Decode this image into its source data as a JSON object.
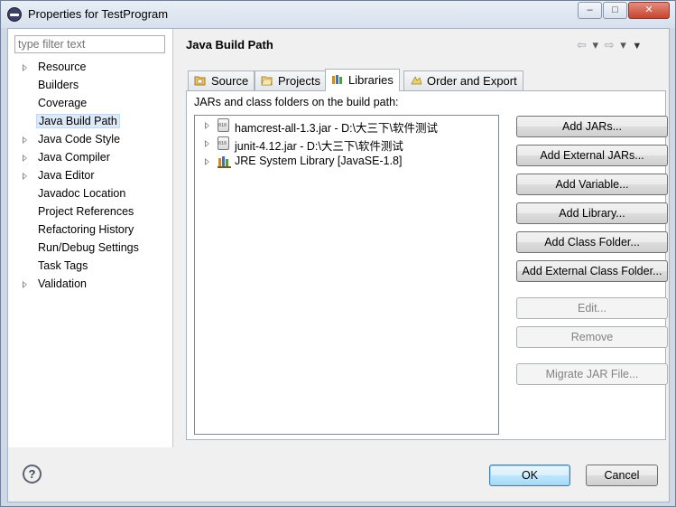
{
  "window": {
    "title": "Properties for TestProgram",
    "min_label": "–",
    "max_label": "□",
    "close_label": "✕"
  },
  "sidebar": {
    "filter_placeholder": "type filter text",
    "items": [
      {
        "label": "Resource",
        "expandable": true
      },
      {
        "label": "Builders",
        "expandable": false
      },
      {
        "label": "Coverage",
        "expandable": false
      },
      {
        "label": "Java Build Path",
        "expandable": false,
        "selected": true
      },
      {
        "label": "Java Code Style",
        "expandable": true
      },
      {
        "label": "Java Compiler",
        "expandable": true
      },
      {
        "label": "Java Editor",
        "expandable": true
      },
      {
        "label": "Javadoc Location",
        "expandable": false
      },
      {
        "label": "Project References",
        "expandable": false
      },
      {
        "label": "Refactoring History",
        "expandable": false
      },
      {
        "label": "Run/Debug Settings",
        "expandable": false
      },
      {
        "label": "Task Tags",
        "expandable": false
      },
      {
        "label": "Validation",
        "expandable": true
      }
    ]
  },
  "page": {
    "title": "Java Build Path",
    "nav": {
      "back": "⇦",
      "back_menu": "▾",
      "forward": "⇨",
      "forward_menu": "▾",
      "view_menu": "▼"
    }
  },
  "tabs": [
    {
      "label": "Source",
      "icon": "source-folder-icon"
    },
    {
      "label": "Projects",
      "icon": "projects-icon"
    },
    {
      "label": "Libraries",
      "icon": "libraries-icon",
      "active": true
    },
    {
      "label": "Order and Export",
      "icon": "order-export-icon"
    }
  ],
  "libraries": {
    "caption": "JARs and class folders on the build path:",
    "entries": [
      {
        "label": "hamcrest-all-1.3.jar - D:\\大三下\\软件测试",
        "icon": "jar-icon"
      },
      {
        "label": "junit-4.12.jar - D:\\大三下\\软件测试",
        "icon": "jar-icon"
      },
      {
        "label": "JRE System Library [JavaSE-1.8]",
        "icon": "library-icon"
      }
    ],
    "buttons": {
      "add_jars": "Add JARs...",
      "add_external_jars": "Add External JARs...",
      "add_variable": "Add Variable...",
      "add_library": "Add Library...",
      "add_class_folder": "Add Class Folder...",
      "add_external_class_folder": "Add External Class Folder...",
      "edit": "Edit...",
      "remove": "Remove",
      "migrate_jar": "Migrate JAR File..."
    }
  },
  "footer": {
    "help": "?",
    "ok": "OK",
    "cancel": "Cancel"
  },
  "colors": {
    "selection": "#dbe9f8",
    "default_button_border": "#3c7fb1",
    "window_frame": "#cfd9e6"
  }
}
